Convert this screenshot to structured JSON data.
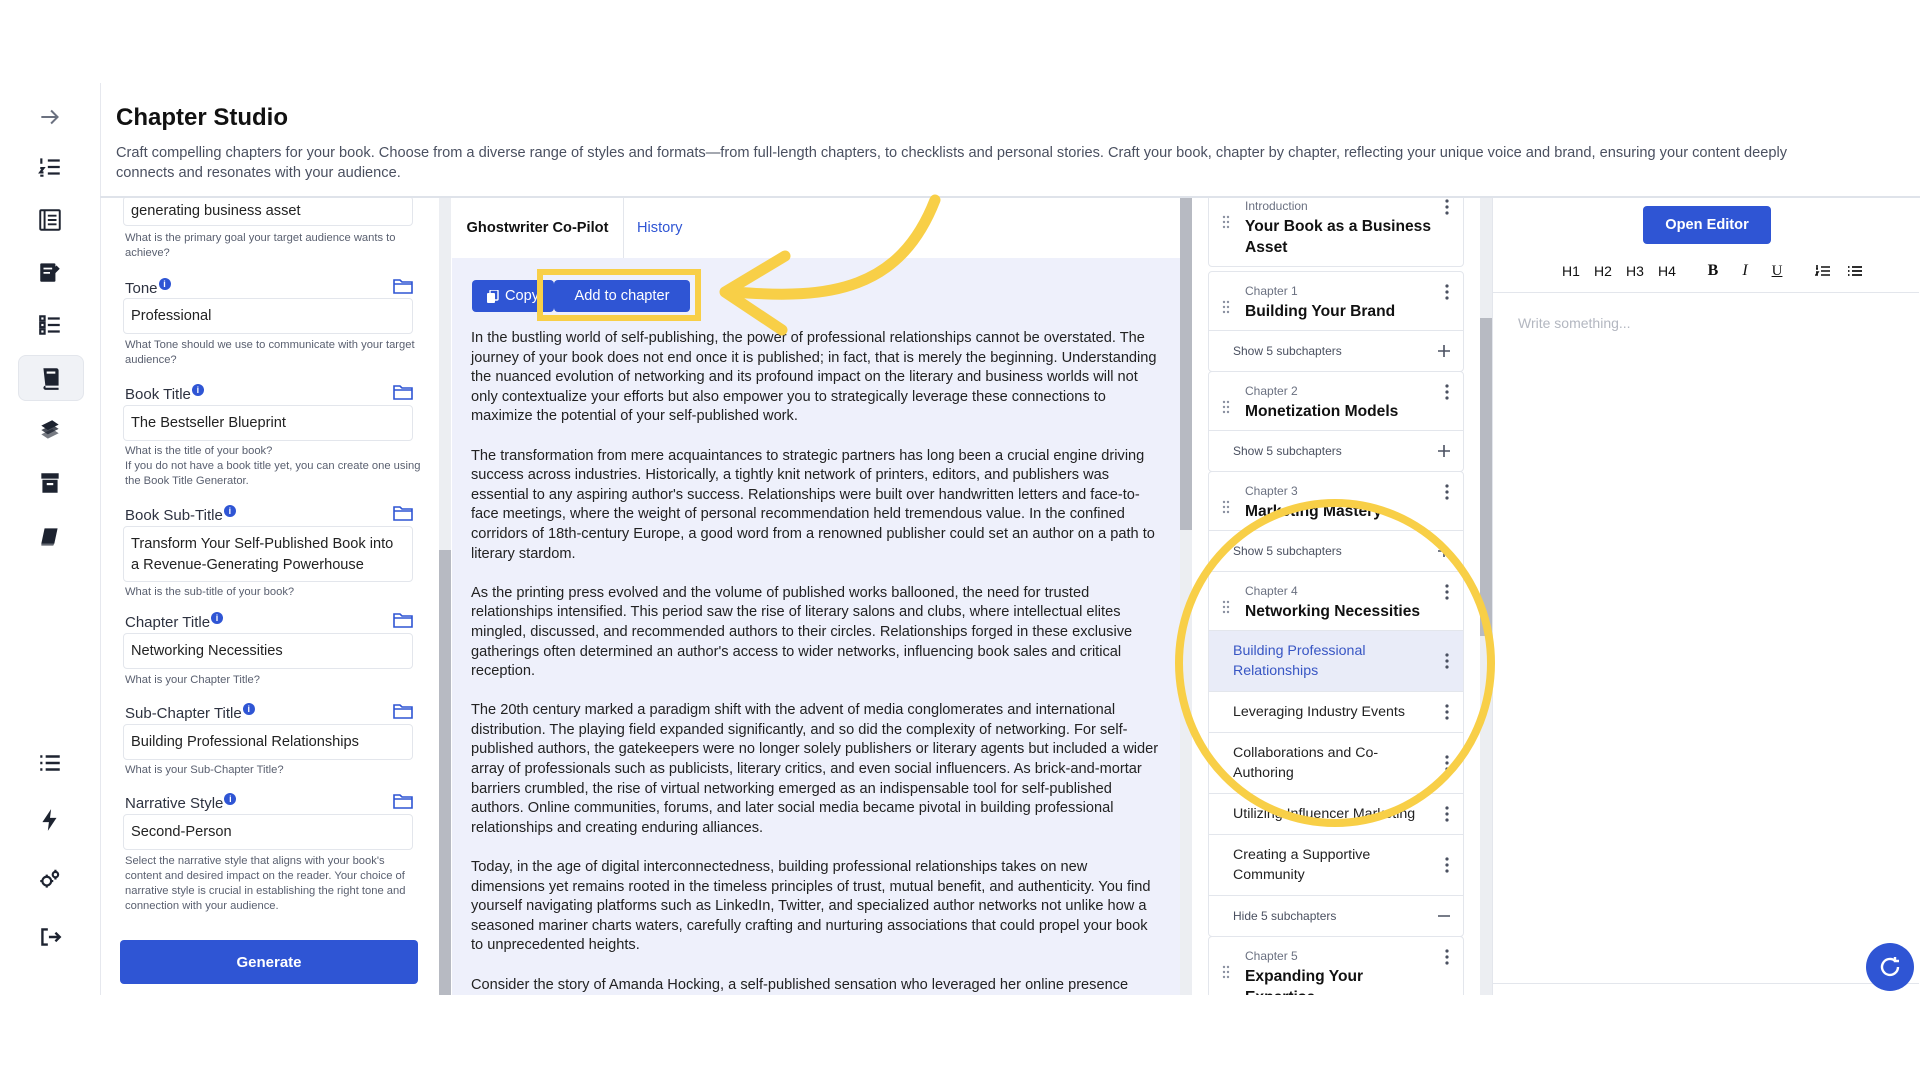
{
  "header": {
    "title": "Chapter Studio",
    "description": "Craft compelling chapters for your book. Choose from a diverse range of styles and formats—from full-length chapters, to checklists and personal stories. Craft your book, chapter by chapter, reflecting your unique voice and brand, ensuring your content deeply connects and resonates with your audience."
  },
  "sidebar": {
    "icons": [
      "arrow-right-icon",
      "list-numbered-icon",
      "book-list-icon",
      "notebook-pen-icon",
      "checklist-icon",
      "book-open-icon",
      "books-stack-icon",
      "archive-icon",
      "book-icon",
      "menu-list-icon",
      "bolt-icon",
      "settings-gears-icon",
      "logout-icon"
    ],
    "active": "book-open-icon"
  },
  "form": {
    "goal": {
      "value": "generating business asset",
      "help": "What is the primary goal your target audience wants to achieve?"
    },
    "tone": {
      "label": "Tone",
      "value": "Professional",
      "help": "What Tone should we use to communicate with your target audience?"
    },
    "book_title": {
      "label": "Book Title",
      "value": "The Bestseller Blueprint",
      "help": "What is the title of your book?",
      "help2": "If you do not have a book title yet, you can create one using the Book Title Generator."
    },
    "book_subtitle": {
      "label": "Book Sub-Title",
      "value": "Transform Your Self-Published Book into a Revenue-Generating Powerhouse",
      "help": "What is the sub-title of your book?"
    },
    "chapter_title": {
      "label": "Chapter Title",
      "value": "Networking Necessities",
      "help": "What is your Chapter Title?"
    },
    "subchapter_title": {
      "label": "Sub-Chapter Title",
      "value": "Building Professional Relationships",
      "help": "What is your Sub-Chapter Title?"
    },
    "narrative_style": {
      "label": "Narrative Style",
      "value": "Second-Person",
      "help": "Select the narrative style that aligns with your book's content and desired impact on the reader. Your choice of narrative style is crucial in establishing the right tone and connection with your audience."
    },
    "generate_label": "Generate"
  },
  "content": {
    "tabs": {
      "ghostwriter": "Ghostwriter Co-Pilot",
      "history": "History"
    },
    "copy_label": "Copy",
    "add_label": "Add to chapter",
    "paragraphs": [
      "In the bustling world of self-publishing, the power of professional relationships cannot be overstated. The journey of your book does not end once it is published; in fact, that is merely the beginning. Understanding the nuanced evolution of networking and its profound impact on the literary and business worlds will not only contextualize your efforts but also empower you to strategically leverage these connections to maximize the potential of your self-published work.",
      "The transformation from mere acquaintances to strategic partners has long been a crucial engine driving success across industries. Historically, a tightly knit network of printers, editors, and publishers was essential to any aspiring author's success. Relationships were built over handwritten letters and face-to-face meetings, where the weight of personal recommendation held tremendous value. In the confined corridors of 18th-century Europe, a good word from a renowned publisher could set an author on a path to literary stardom.",
      "As the printing press evolved and the volume of published works ballooned, the need for trusted relationships intensified. This period saw the rise of literary salons and clubs, where intellectual elites mingled, discussed, and recommended authors to their circles. Relationships forged in these exclusive gatherings often determined an author's access to wider networks, influencing book sales and critical reception.",
      "The 20th century marked a paradigm shift with the advent of media conglomerates and international distribution. The playing field expanded significantly, and so did the complexity of networking. For self-published authors, the gatekeepers were no longer solely publishers or literary agents but included a wider array of professionals such as publicists, literary critics, and even social influencers. As brick-and-mortar barriers crumbled, the rise of virtual networking emerged as an indispensable tool for self-published authors. Online communities, forums, and later social media became pivotal in building professional relationships and creating enduring alliances.",
      "Today, in the age of digital interconnectedness, building professional relationships takes on new dimensions yet remains rooted in the timeless principles of trust, mutual benefit, and authenticity. You find yourself navigating platforms such as LinkedIn, Twitter, and specialized author networks not unlike how a seasoned mariner charts waters, carefully crafting and nurturing associations that could propel your book to unprecedented heights.",
      "Consider the story of Amanda Hocking, a self-published sensation who leveraged her online presence"
    ]
  },
  "outline": {
    "intro": {
      "label": "Introduction",
      "title": "Your Book as a Business Asset"
    },
    "chapters": [
      {
        "label": "Chapter 1",
        "title": "Building Your Brand",
        "toggle": "Show 5 subchapters"
      },
      {
        "label": "Chapter 2",
        "title": "Monetization Models",
        "toggle": "Show 5 subchapters"
      },
      {
        "label": "Chapter 3",
        "title": "Marketing Mastery",
        "toggle": "Show 5 subchapters"
      },
      {
        "label": "Chapter 4",
        "title": "Networking Necessities",
        "toggle": "Hide 5 subchapters",
        "subchapters": [
          "Building Professional Relationships",
          "Leveraging Industry Events",
          "Collaborations and Co-Authoring",
          "Utilizing Influencer Marketing",
          "Creating a Supportive Community"
        ]
      },
      {
        "label": "Chapter 5",
        "title": "Expanding Your Expertise"
      }
    ]
  },
  "editor": {
    "open_label": "Open Editor",
    "toolbar": [
      "H1",
      "H2",
      "H3",
      "H4",
      "B",
      "I",
      "U"
    ],
    "placeholder": "Write something..."
  },
  "colors": {
    "accent": "#2f55d4",
    "highlight": "#f8cf47"
  }
}
